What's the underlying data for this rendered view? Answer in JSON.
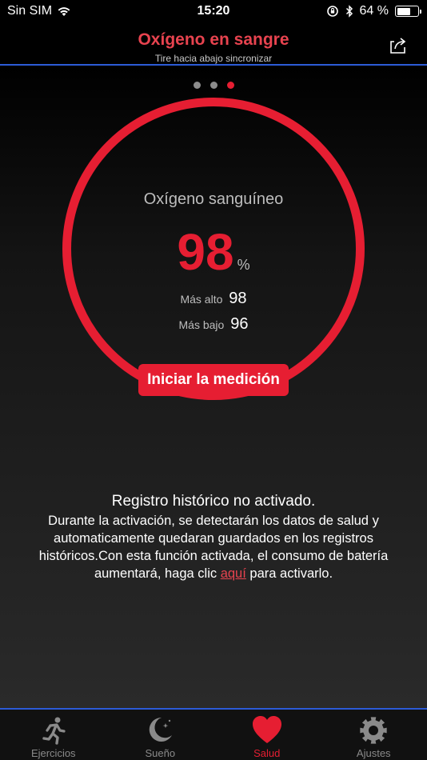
{
  "status_bar": {
    "carrier": "Sin SIM",
    "time": "15:20",
    "battery_text": "64 %",
    "battery_level": 0.64
  },
  "header": {
    "title": "Oxígeno en sangre",
    "subtitle": "Tire hacia abajo sincronizar"
  },
  "pager": {
    "count": 3,
    "active_index": 2
  },
  "measurement": {
    "label": "Oxígeno sanguíneo",
    "value": "98",
    "unit": "%",
    "highest_label": "Más alto",
    "highest_value": "98",
    "lowest_label": "Más bajo",
    "lowest_value": "96",
    "start_button": "Iniciar la medición"
  },
  "info": {
    "title": "Registro histórico no activado.",
    "text_before_link": "Durante la activación, se detectarán los datos de salud y automaticamente quedaran guardados en los registros históricos.Con esta función activada, el consumo de batería aumentará, haga clic ",
    "link_text": "aquí",
    "text_after_link": " para activarlo."
  },
  "tabs": [
    {
      "label": "Ejercicios",
      "icon": "running-icon"
    },
    {
      "label": "Sueño",
      "icon": "moon-icon"
    },
    {
      "label": "Salud",
      "icon": "heart-icon",
      "active": true
    },
    {
      "label": "Ajustes",
      "icon": "gear-icon"
    }
  ],
  "colors": {
    "accent": "#e61e32",
    "divider": "#2c5bd6"
  }
}
